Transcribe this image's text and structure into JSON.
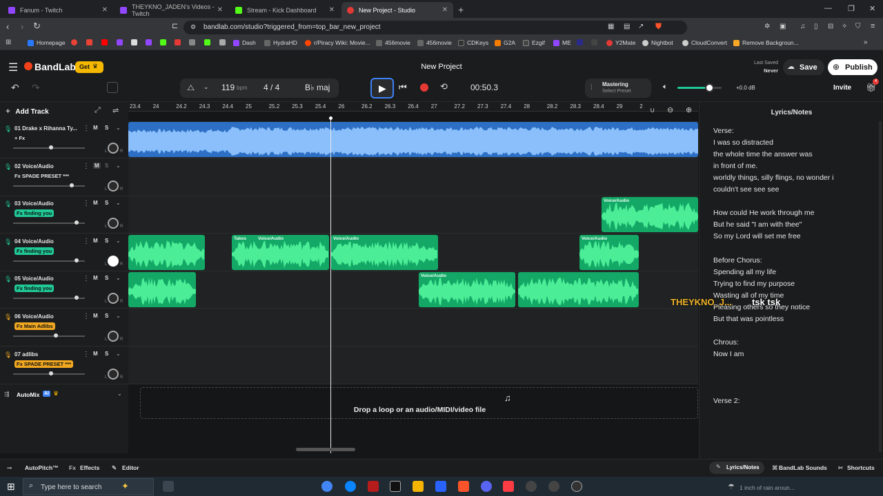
{
  "browser": {
    "tabs": [
      {
        "label": "Fanum - Twitch",
        "color": "#9146ff"
      },
      {
        "label": "THEYKNO_JADEN's Videos - Twitch",
        "color": "#9146ff"
      },
      {
        "label": "Stream - Kick Dashboard",
        "color": "#53fc18"
      },
      {
        "label": "New Project - Studio",
        "color": "#e53935",
        "active": true
      }
    ],
    "url": "bandlab.com/studio?triggered_from=top_bar_new_project",
    "bookmarks": [
      {
        "label": "Homepage",
        "color": "#2979ff"
      },
      {
        "label": "",
        "color": "#ea4335"
      },
      {
        "label": "",
        "color": "#ea4335"
      },
      {
        "label": "",
        "color": "#ff0000"
      },
      {
        "label": "",
        "color": "#9146ff"
      },
      {
        "label": "",
        "color": "#53fc18"
      },
      {
        "label": "",
        "color": "#e53935"
      },
      {
        "label": "",
        "color": "#888888"
      },
      {
        "label": "",
        "color": "#53fc18"
      },
      {
        "label": "Dash",
        "color": "#9146ff"
      },
      {
        "label": "HydraHD",
        "color": "#444444"
      },
      {
        "label": "r/Piracy Wiki: Movie...",
        "color": "#ff4500"
      },
      {
        "label": "456movie",
        "color": "#666666"
      },
      {
        "label": "456movie",
        "color": "#666666"
      },
      {
        "label": "CDKeys",
        "color": "#333333"
      },
      {
        "label": "G2A",
        "color": "#f57c00"
      },
      {
        "label": "Ezgif",
        "color": "#444444"
      },
      {
        "label": "ME",
        "color": "#9146ff"
      },
      {
        "label": "Y2Mate",
        "color": "#e53935"
      },
      {
        "label": "Nightbot",
        "color": "#cccccc"
      },
      {
        "label": "CloudConvert",
        "color": "#cccccc"
      },
      {
        "label": "Remove Backgroun...",
        "color": "#f9a825"
      }
    ]
  },
  "app": {
    "brand": "BandLab",
    "get_label": "Get",
    "project_title": "New Project",
    "last_saved_label": "Last Saved",
    "last_saved_value": "Never",
    "save_label": "Save",
    "publish_label": "Publish",
    "invite_label": "Invite",
    "gift_badge": "4"
  },
  "transport": {
    "bpm": "119",
    "bpm_unit": "bpm",
    "time_sig": "4 / 4",
    "key": "B♭ maj",
    "time": "00:50.3",
    "mastering_label": "Mastering",
    "mastering_preset": "Select Preset",
    "master_db": "+0.0 dB",
    "master_volume": 0.72
  },
  "ruler": [
    "23.4",
    "24",
    "24.2",
    "24.3",
    "24.4",
    "25",
    "25.2",
    "25.3",
    "25.4",
    "26",
    "26.2",
    "26.3",
    "26.4",
    "27",
    "27.2",
    "27.3",
    "27.4",
    "28",
    "28.2",
    "28.3",
    "28.4",
    "29",
    "2"
  ],
  "add_track_label": "Add Track",
  "tracks": [
    {
      "num": "01",
      "name": "Drake x Rihanna Ty...",
      "fx": "+ Fx",
      "fx_color": "",
      "volume": 0.53
    },
    {
      "num": "02",
      "name": "Voice/Audio",
      "fx": "Fx SPADE PRESET ***",
      "fx_color": "",
      "volume": 0.82
    },
    {
      "num": "03",
      "name": "Voice/Audio",
      "fx": "Fx finding you",
      "fx_color": "#20c997",
      "volume": 0.88
    },
    {
      "num": "04",
      "name": "Voice/Audio",
      "fx": "Fx finding you",
      "fx_color": "#20c997",
      "volume": 0.88
    },
    {
      "num": "05",
      "name": "Voice/Audio",
      "fx": "Fx finding you",
      "fx_color": "#20c997",
      "volume": 0.88
    },
    {
      "num": "06",
      "name": "Voice/Audio",
      "fx": "Fx Main Adlibs",
      "fx_color": "#f0a821",
      "volume": 0.6
    },
    {
      "num": "07",
      "name": "adlibs",
      "fx": "Fx SPADE PRESET ***",
      "fx_color": "#f0a821",
      "volume": 0.53
    }
  ],
  "clip_labels": {
    "voice": "Voice/Audio",
    "takes": "Takes"
  },
  "automix_label": "AutoMix",
  "automix_badge": "AI",
  "drop_text": "Drop a loop or an audio/MIDI/video file",
  "lyrics": {
    "title": "Lyrics/Notes",
    "lines": [
      "Verse:",
      "I was so distracted",
      "the whole time the answer was",
      "in front of me.",
      "worldly things, silly flings, no wonder i",
      "couldn't see see see",
      "",
      "How could He work through me",
      "But he said \"I am with thee\"",
      "So my Lord will set me free",
      "",
      "Before Chorus:",
      "Spending all my life",
      "Trying to find my purpose",
      "Wasting all of my time",
      "Pleasing others so they notice",
      "But that was pointless",
      "",
      "Chrous:",
      "Now I am",
      "",
      "",
      "",
      "Verse 2:"
    ]
  },
  "overlay": {
    "a": "THEYKNO_J...",
    "b": "tsk tsk"
  },
  "bottom": {
    "autopitch": "AutoPitch™",
    "effects": "Effects",
    "editor": "Editor",
    "lyrics_tab": "Lyrics/Notes",
    "sounds_tab": "BandLab Sounds",
    "shortcuts": "Shortcuts"
  },
  "taskbar": {
    "search_placeholder": "Type here to search",
    "weather": "1 inch of rain aroun..."
  }
}
